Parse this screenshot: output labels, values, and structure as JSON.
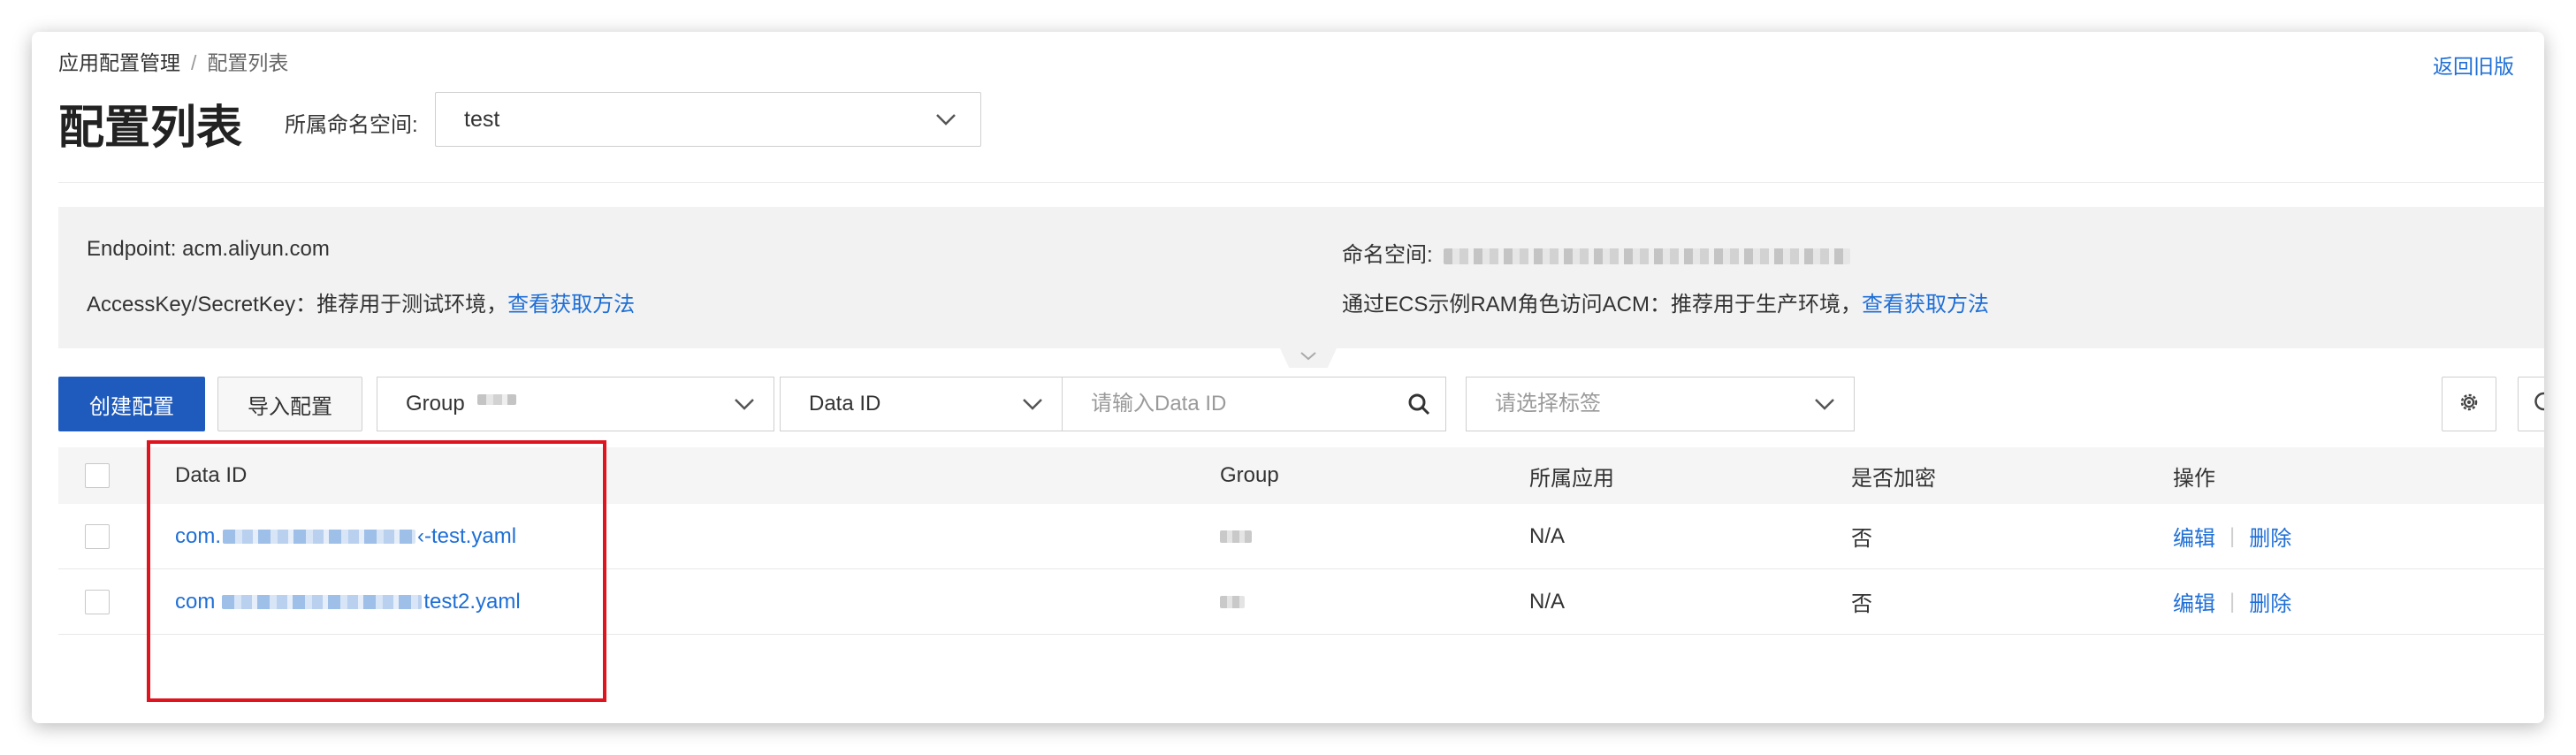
{
  "breadcrumb": {
    "parent": "应用配置管理",
    "separator": "/",
    "current": "配置列表"
  },
  "header": {
    "back_link": "返回旧版",
    "title": "配置列表",
    "namespace_label": "所属命名空间:",
    "namespace_value": "test"
  },
  "info": {
    "endpoint_label": "Endpoint:",
    "endpoint_value": "acm.aliyun.com",
    "accesskey_text": "AccessKey/SecretKey：推荐用于测试环境，",
    "accesskey_link": "查看获取方法",
    "namespace_label": "命名空间:",
    "ecs_text": "通过ECS示例RAM角色访问ACM：推荐用于生产环境，",
    "ecs_link": "查看获取方法"
  },
  "toolbar": {
    "create_button": "创建配置",
    "import_button": "导入配置",
    "group_label": "Group",
    "dataid_type": "Data ID",
    "dataid_placeholder": "请输入Data ID",
    "tag_placeholder": "请选择标签"
  },
  "table": {
    "columns": [
      "Data ID",
      "Group",
      "所属应用",
      "是否加密",
      "操作"
    ],
    "rows": [
      {
        "data_id_prefix": "com.",
        "data_id_suffix": "‹-test.yaml",
        "app": "N/A",
        "encrypted": "否",
        "edit": "编辑",
        "delete": "删除"
      },
      {
        "data_id_prefix": "com",
        "data_id_suffix": "test2.yaml",
        "app": "N/A",
        "encrypted": "否",
        "edit": "编辑",
        "delete": "删除"
      }
    ]
  },
  "colors": {
    "accent": "#1f5bbd",
    "link": "#1f6fd6",
    "highlight": "#e0141e",
    "panel": "#f2f2f2"
  }
}
